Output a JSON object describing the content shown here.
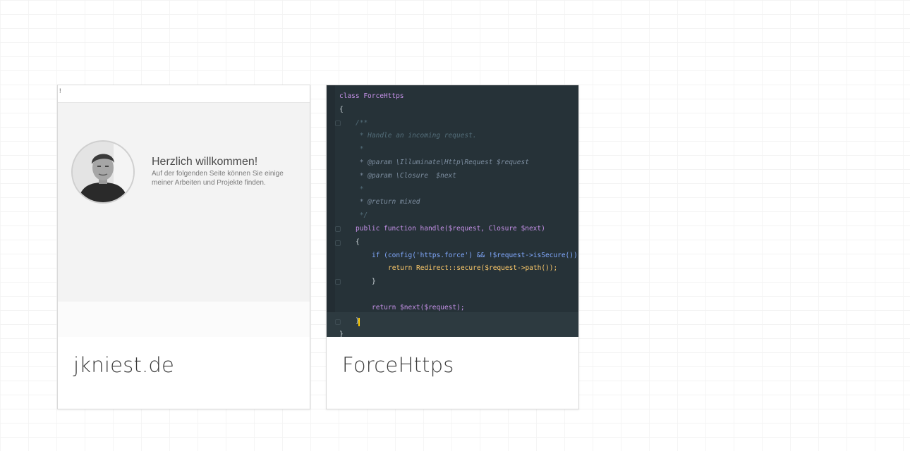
{
  "cards": [
    {
      "title": "jkniest.de",
      "thumbnail": {
        "topbar_mark": "!",
        "heading": "Herzlich willkommen!",
        "subtext": "Auf der folgenden Seite können Sie einige meiner Arbeiten und Projekte finden."
      }
    },
    {
      "title": "ForceHttps",
      "thumbnail": {
        "code_lines": [
          "class ForceHttps",
          "{",
          "/**",
          " * Handle an incoming request.",
          " *",
          " * @param \\Illuminate\\Http\\Request $request",
          " * @param \\Closure  $next",
          " *",
          " * @return mixed",
          " */",
          "public function handle($request, Closure $next)",
          "{",
          "if (config('https.force') && !$request->isSecure())",
          "return Redirect::secure($request->path());",
          "}",
          "return $next($request);",
          "}",
          "}"
        ]
      }
    }
  ],
  "colors": {
    "code_background": "#263238",
    "keyword": "#c792ea",
    "class_name": "#ffcb6b",
    "variable": "#f07178",
    "function": "#82aaff",
    "string": "#c3e88d",
    "comment": "#546e7a",
    "cursor": "#ffcc00"
  }
}
